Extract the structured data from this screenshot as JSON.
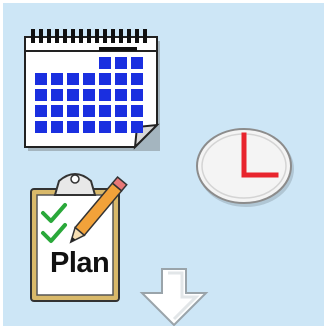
{
  "icons": [
    {
      "name": "calendar-icon"
    },
    {
      "name": "clock-icon"
    },
    {
      "name": "plan-clipboard-icon"
    },
    {
      "name": "down-arrow-icon"
    }
  ],
  "plan": {
    "label": "Plan"
  },
  "colors": {
    "panel_background": "#cde6f6",
    "calendar_grid": "#1a2fe0",
    "clock_hands": "#e8242d",
    "checkmark": "#2aa83a"
  }
}
